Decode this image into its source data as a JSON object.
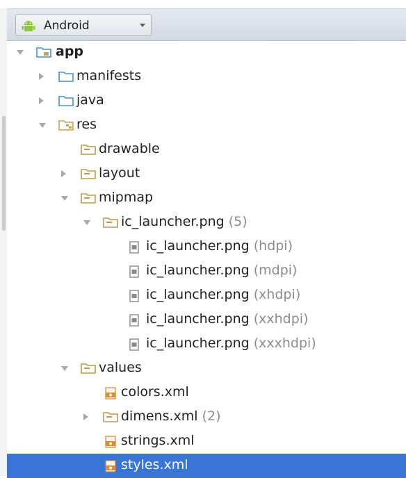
{
  "toolbar": {
    "view_selector": {
      "label": "Android",
      "icon": "android-icon"
    }
  },
  "tree": {
    "app": {
      "label": "app",
      "icon": "module-folder-icon"
    },
    "manifests": {
      "label": "manifests",
      "icon": "folder-icon"
    },
    "java": {
      "label": "java",
      "icon": "folder-icon"
    },
    "res": {
      "label": "res",
      "icon": "resource-root-folder-icon"
    },
    "drawable": {
      "label": "drawable",
      "icon": "resource-folder-icon"
    },
    "layout": {
      "label": "layout",
      "icon": "resource-folder-icon"
    },
    "mipmap": {
      "label": "mipmap",
      "icon": "resource-folder-icon"
    },
    "ic_launcher_group": {
      "label": "ic_launcher.png",
      "count": "(5)",
      "icon": "resource-folder-icon"
    },
    "ic_launcher_files": [
      {
        "label": "ic_launcher.png",
        "qualifier": "(hdpi)",
        "icon": "image-file-icon"
      },
      {
        "label": "ic_launcher.png",
        "qualifier": "(mdpi)",
        "icon": "image-file-icon"
      },
      {
        "label": "ic_launcher.png",
        "qualifier": "(xhdpi)",
        "icon": "image-file-icon"
      },
      {
        "label": "ic_launcher.png",
        "qualifier": "(xxhdpi)",
        "icon": "image-file-icon"
      },
      {
        "label": "ic_launcher.png",
        "qualifier": "(xxxhdpi)",
        "icon": "image-file-icon"
      }
    ],
    "values": {
      "label": "values",
      "icon": "resource-folder-icon"
    },
    "colors": {
      "label": "colors.xml",
      "icon": "xml-file-icon"
    },
    "dimens": {
      "label": "dimens.xml",
      "count": "(2)",
      "icon": "resource-folder-icon"
    },
    "strings": {
      "label": "strings.xml",
      "icon": "xml-file-icon"
    },
    "styles": {
      "label": "styles.xml",
      "icon": "xml-file-icon",
      "selected": true
    }
  },
  "colors": {
    "selection": "#3875d7",
    "folder": "#4a8fcf",
    "resource_folder": "#c7a34c",
    "android_green": "#8ec63f",
    "xml_file": "#e08a2d"
  }
}
